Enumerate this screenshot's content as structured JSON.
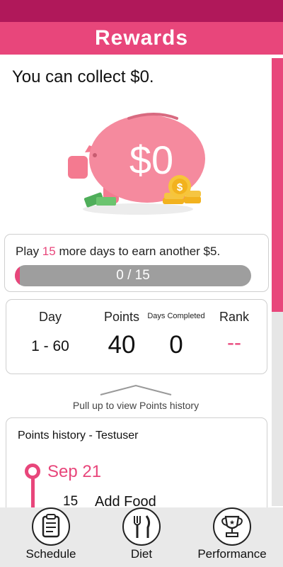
{
  "header": {
    "title": "Rewards"
  },
  "rewards": {
    "collect_text": "You can collect $0.",
    "piggy_amount": "$0"
  },
  "earn": {
    "prefix": "Play ",
    "days": "15",
    "suffix": " more days to earn another $5.",
    "progress_label": "0 / 15",
    "progress_fraction": 0.02
  },
  "stats": {
    "day_label": "Day",
    "day_value": "1 - 60",
    "points_label": "Points",
    "points_value": "40",
    "days_completed_label": "Days Completed",
    "days_completed_value": "0",
    "rank_label": "Rank",
    "rank_value": "--"
  },
  "pull_hint": "Pull up to view Points history",
  "history": {
    "title": "Points history - Testuser",
    "date": "Sep 21",
    "entries": [
      {
        "points": "15",
        "label": "Add Food"
      }
    ]
  },
  "nav": {
    "items": [
      {
        "label": "Schedule",
        "icon": "clipboard-icon"
      },
      {
        "label": "Diet",
        "icon": "fork-knife-icon"
      },
      {
        "label": "Performance",
        "icon": "trophy-icon"
      }
    ]
  },
  "colors": {
    "accent": "#e8467b",
    "status_bar": "#b0185a",
    "progress_track": "#9e9e9e"
  }
}
